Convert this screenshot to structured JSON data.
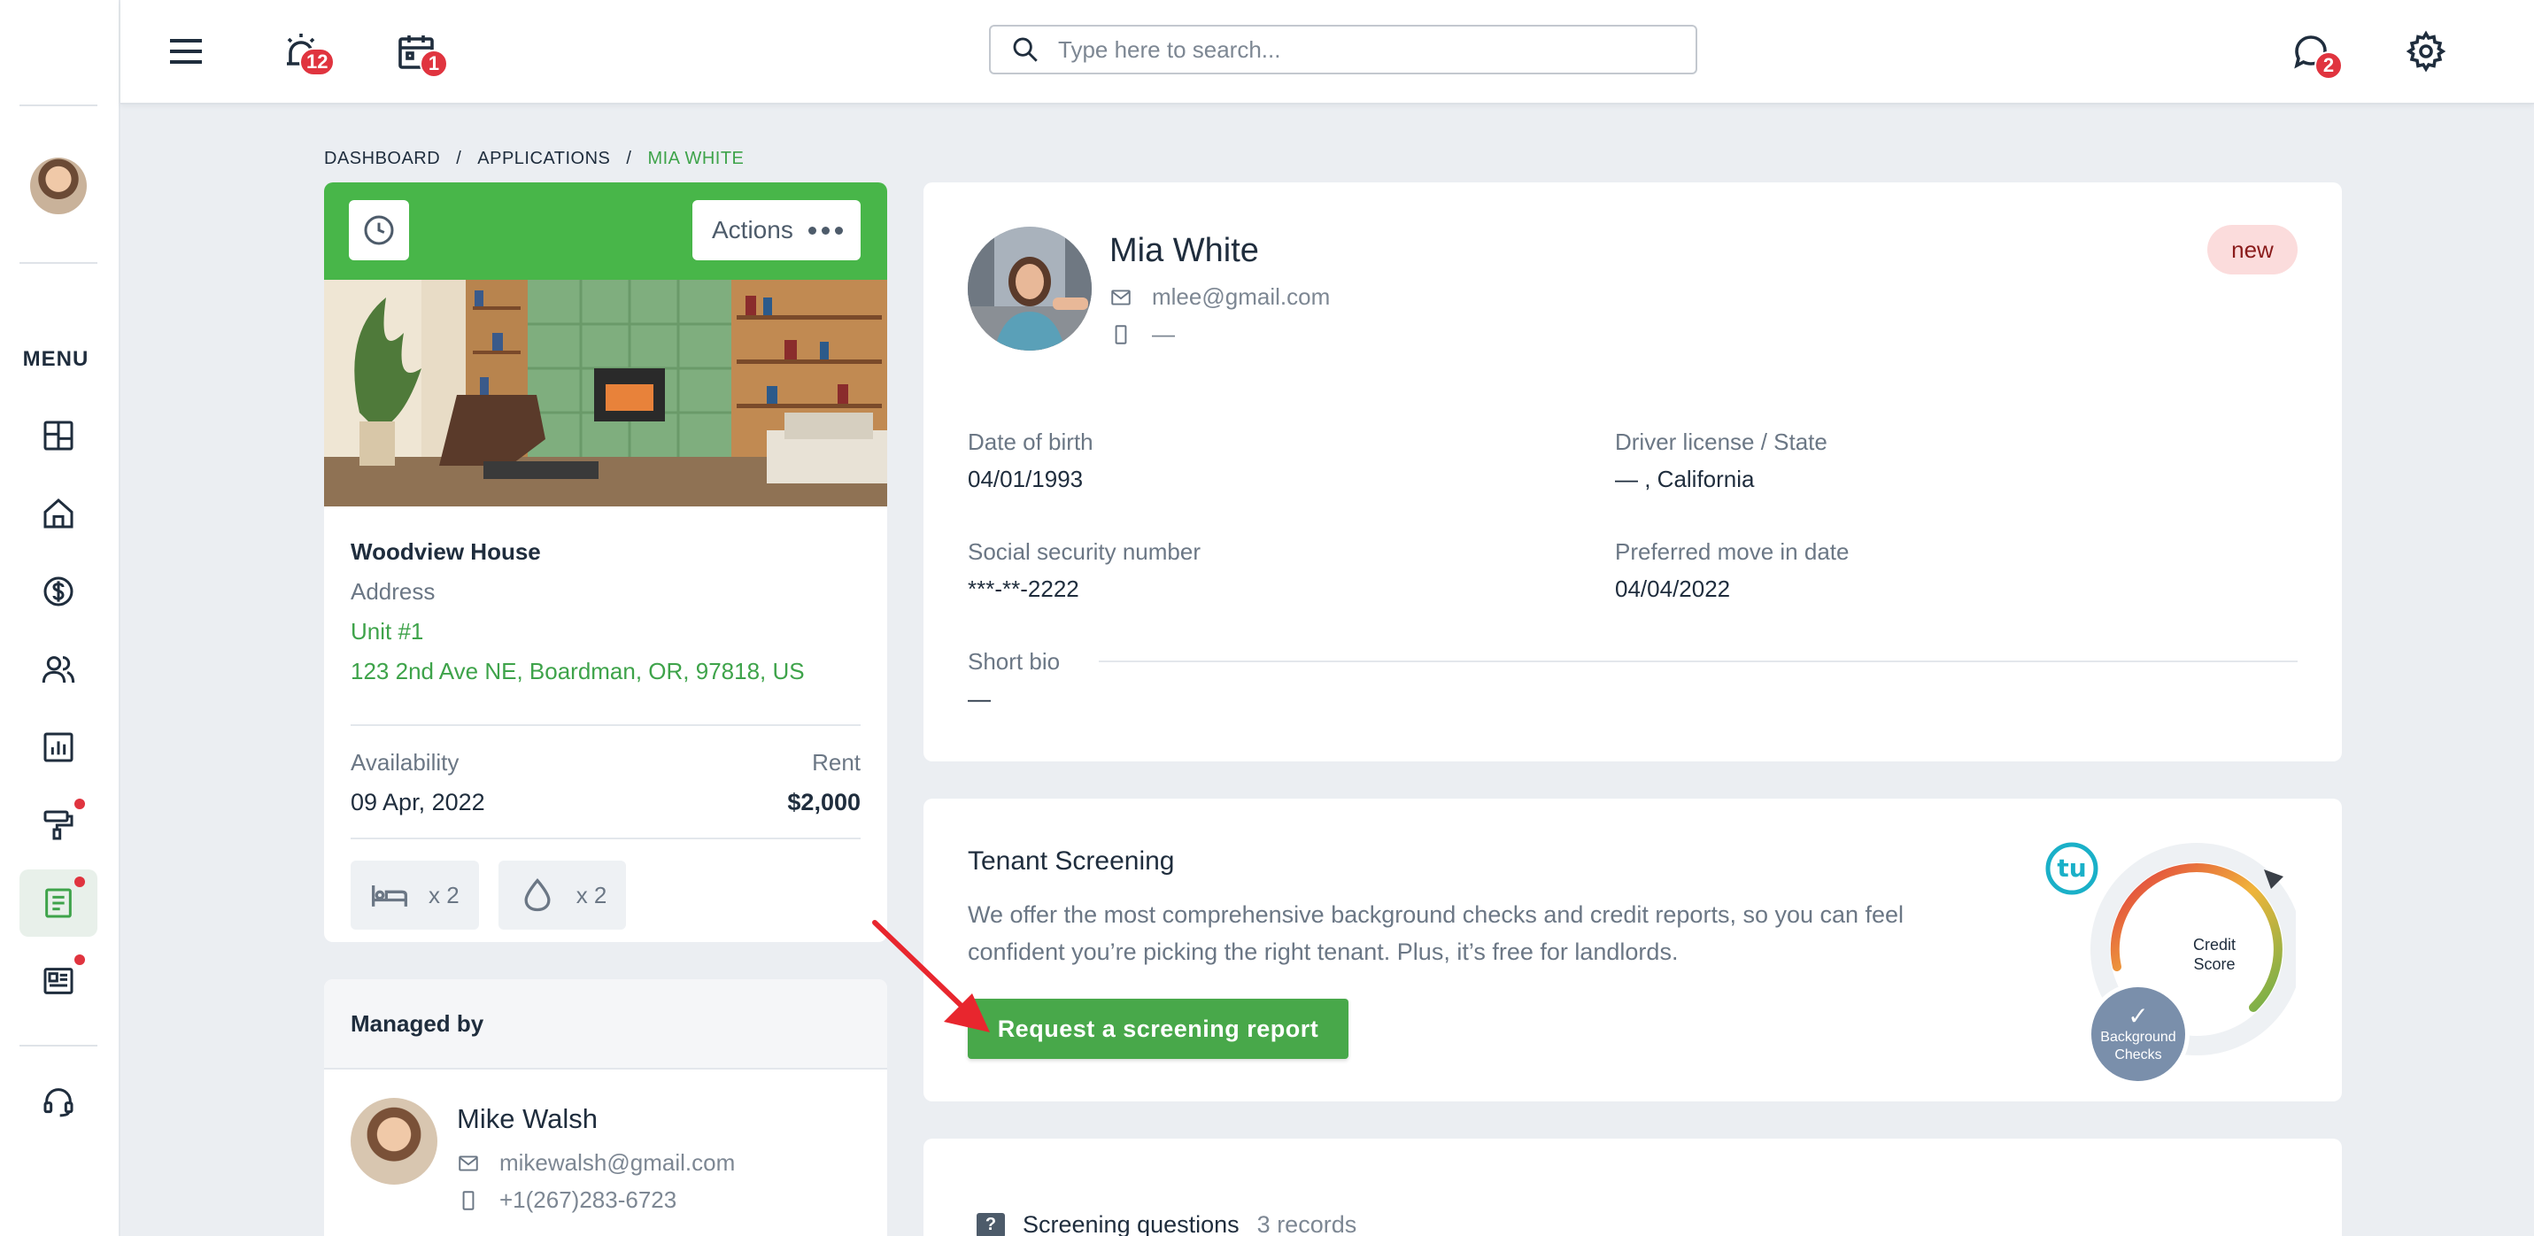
{
  "header": {
    "search_placeholder": "Type here to search...",
    "alarm_badge": "12",
    "calendar_badge": "1",
    "chat_badge": "2"
  },
  "sidebar": {
    "menu_label": "MENU",
    "items": [
      {
        "icon": "dashboard-icon"
      },
      {
        "icon": "home-icon"
      },
      {
        "icon": "dollar-icon"
      },
      {
        "icon": "users-icon"
      },
      {
        "icon": "chart-icon"
      },
      {
        "icon": "paint-roller-icon",
        "dot": true
      },
      {
        "icon": "document-icon",
        "dot": true,
        "active": true
      },
      {
        "icon": "newspaper-icon",
        "dot": true
      },
      {
        "icon": "support-headset-icon"
      }
    ]
  },
  "breadcrumb": {
    "items": [
      "DASHBOARD",
      "/",
      "APPLICATIONS",
      "/",
      "MIA WHITE"
    ]
  },
  "property": {
    "actions_label": "Actions",
    "name": "Woodview House",
    "address_label": "Address",
    "unit": "Unit #1",
    "address": "123 2nd Ave NE, Boardman, OR, 97818, US",
    "availability_label": "Availability",
    "rent_label": "Rent",
    "availability": "09 Apr, 2022",
    "rent": "$2,000",
    "beds": "x 2",
    "baths": "x 2"
  },
  "managed": {
    "title": "Managed by",
    "name": "Mike Walsh",
    "email": "mikewalsh@gmail.com",
    "phone": "+1(267)283-6723"
  },
  "applicant": {
    "name": "Mia White",
    "email": "mlee@gmail.com",
    "phone": "—",
    "status": "new",
    "dob_label": "Date of birth",
    "dob": "04/01/1993",
    "license_label": "Driver license / State",
    "license": "— , California",
    "ssn_label": "Social security number",
    "ssn": "***-**-2222",
    "move_label": "Preferred move in date",
    "move": "04/04/2022",
    "bio_label": "Short bio",
    "bio": "—"
  },
  "screening": {
    "title": "Tenant Screening",
    "description": "We offer the most comprehensive background checks and credit reports, so you can feel confident you’re picking the right tenant. Plus, it’s free for landlords.",
    "button": "Request a screening report",
    "gauge_line1": "Credit",
    "gauge_line2": "Score",
    "bg_line1": "Background",
    "bg_line2": "Checks",
    "check": "✓",
    "logo": "tu"
  },
  "questions": {
    "icon": "?",
    "title": "Screening questions",
    "count": "3 records"
  },
  "colors": {
    "accent_green": "#48b649",
    "badge_red": "#e0343f",
    "text_dark": "#1f2d3d",
    "text_muted": "#6b7785"
  }
}
